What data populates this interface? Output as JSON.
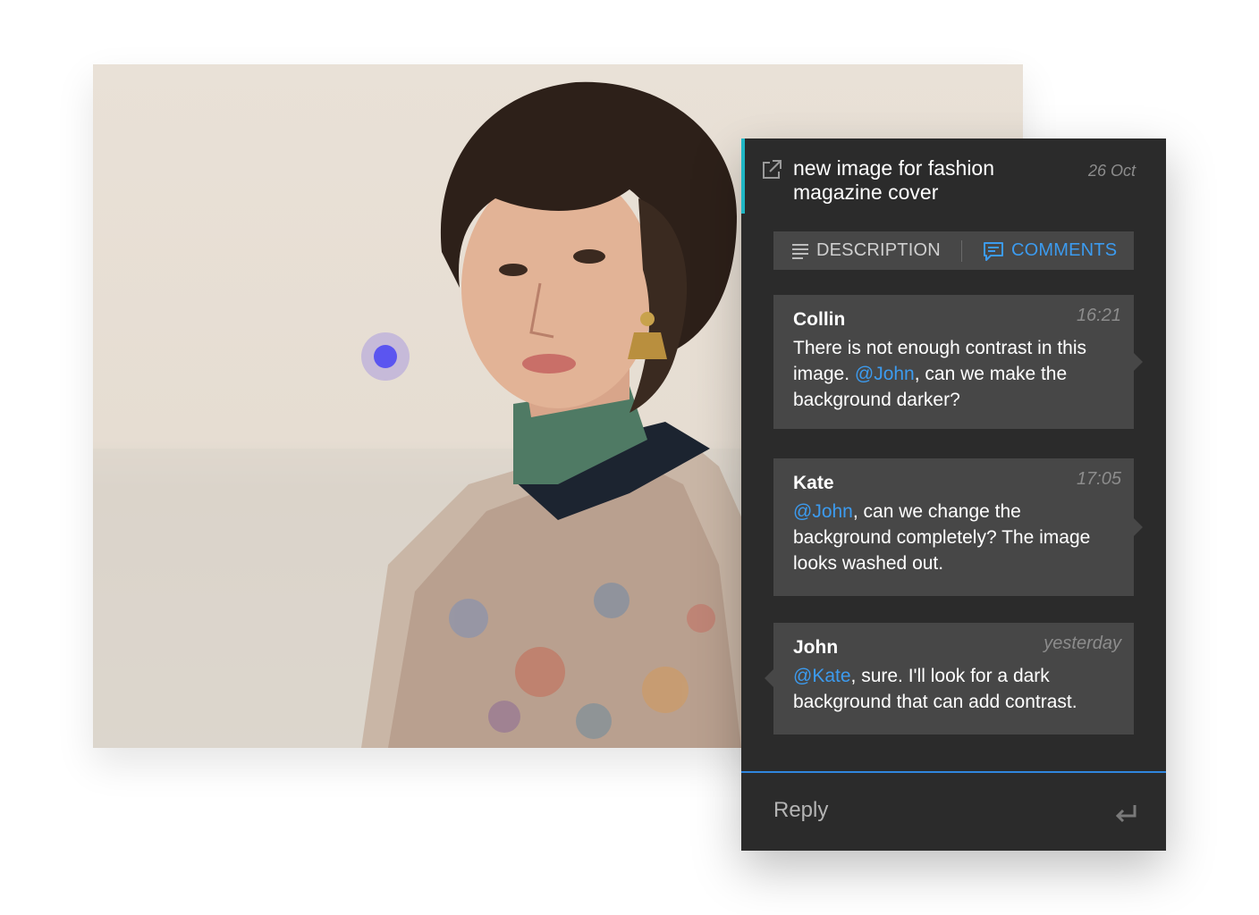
{
  "card": {
    "title": "new image for fashion magazine cover",
    "date": "26 Oct",
    "open_icon": "external-link-icon",
    "accent_color": "#1fb6c4"
  },
  "tabs": [
    {
      "label": "DESCRIPTION",
      "icon": "lines-icon",
      "active": false
    },
    {
      "label": "COMMENTS",
      "icon": "comment-icon",
      "active": true
    }
  ],
  "comments": [
    {
      "author": "Collin",
      "time": "16:21",
      "parts": [
        {
          "text": "There is not enough contrast in this image. "
        },
        {
          "text": "@John",
          "mention": true
        },
        {
          "text": ", can we make the background darker?"
        }
      ]
    },
    {
      "author": "Kate",
      "time": "17:05",
      "parts": [
        {
          "text": "@John",
          "mention": true
        },
        {
          "text": ", can we change the background completely? The image looks washed out."
        }
      ]
    },
    {
      "author": "John",
      "time": "yesterday",
      "parts": [
        {
          "text": "@Kate",
          "mention": true
        },
        {
          "text": ", sure. I'll look for a dark background that can add contrast."
        }
      ]
    }
  ],
  "reply": {
    "placeholder": "Reply",
    "submit_icon": "enter-icon"
  },
  "annotation_pin": {
    "color": "#5b55f0"
  },
  "colors": {
    "panel_bg": "#2b2b2b",
    "card_bg": "#474747",
    "link": "#3c9bef",
    "reply_border": "#2f86de"
  }
}
